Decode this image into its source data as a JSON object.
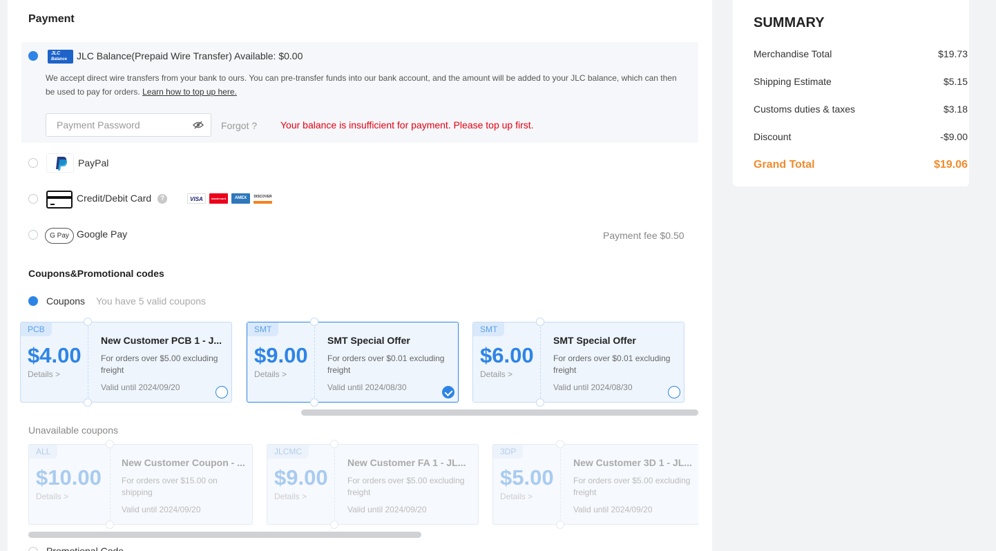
{
  "payment": {
    "title": "Payment",
    "jlc_logo": [
      "JLC",
      "Balance"
    ],
    "jlc_label": "JLC Balance(Prepaid Wire Transfer) Available: $0.00",
    "jlc_desc": "We accept direct wire transfers from your bank to ours. You can pre-transfer funds into our bank account, and the amount will be added to your JLC balance, which can then be used to pay for orders.",
    "jlc_link": "Learn how to top up here.",
    "password_placeholder": "Payment Password",
    "forgot": "Forgot ?",
    "error": "Your balance is insufficient for payment. Please top up first.",
    "paypal": "PayPal",
    "card": "Credit/Debit Card",
    "card_help": "?",
    "card_logos": [
      "VISA",
      "mastercard",
      "AMEX",
      "DISCOVER"
    ],
    "google_pay_logo": "G Pay",
    "google_pay": "Google Pay",
    "fee": "Payment fee $0.50"
  },
  "coupons": {
    "title": "Coupons&Promotional codes",
    "label": "Coupons",
    "hint": "You have 5 valid coupons",
    "available": [
      {
        "cat": "PCB",
        "amount": "$4.00",
        "details": "Details >",
        "title": "New Customer PCB 1 - J...",
        "desc": "For orders over $5.00 excluding freight",
        "valid": "Valid until 2024/09/20",
        "selected": false
      },
      {
        "cat": "SMT",
        "amount": "$9.00",
        "details": "Details >",
        "title": "SMT Special Offer",
        "desc": "For orders over $0.01 excluding freight",
        "valid": "Valid until 2024/08/30",
        "selected": true
      },
      {
        "cat": "SMT",
        "amount": "$6.00",
        "details": "Details >",
        "title": "SMT Special Offer",
        "desc": "For orders over $0.01 excluding freight",
        "valid": "Valid until 2024/08/30",
        "selected": false
      }
    ],
    "unavailable_title": "Unavailable coupons",
    "unavailable": [
      {
        "cat": "ALL",
        "amount": "$10.00",
        "details": "Details >",
        "title": "New Customer Coupon - ...",
        "desc": "For orders over $15.00 on shipping",
        "valid": "Valid until 2024/09/20"
      },
      {
        "cat": "JLCMC",
        "amount": "$9.00",
        "details": "Details >",
        "title": "New Customer FA 1 - JL...",
        "desc": "For orders over $5.00 excluding freight",
        "valid": "Valid until 2024/09/20"
      },
      {
        "cat": "3DP",
        "amount": "$5.00",
        "details": "Details >",
        "title": "New Customer 3D 1 - JL...",
        "desc": "For orders over $5.00 excluding freight",
        "valid": "Valid until 2024/09/20"
      }
    ],
    "promo_label": "Promotional Code"
  },
  "summary": {
    "title": "SUMMARY",
    "rows": [
      {
        "label": "Merchandise Total",
        "value": "$19.73"
      },
      {
        "label": "Shipping Estimate",
        "value": "$5.15"
      },
      {
        "label": "Customs duties & taxes",
        "value": "$3.18"
      },
      {
        "label": "Discount",
        "value": "-$9.00"
      }
    ],
    "grand_label": "Grand Total",
    "grand_value": "$19.06"
  },
  "colors": {
    "accent": "#2e84e6",
    "error": "#e60012",
    "grand_total": "#f08b2c"
  }
}
